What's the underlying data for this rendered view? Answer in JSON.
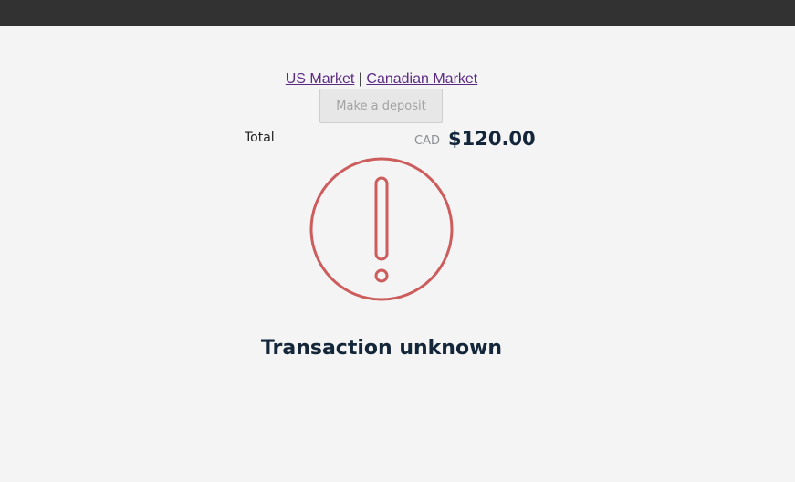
{
  "nav": {
    "us_market": "US Market",
    "separator": "|",
    "canadian_market": "Canadian Market"
  },
  "deposit": {
    "button_label": "Make a deposit"
  },
  "summary": {
    "total_label": "Total",
    "currency": "CAD",
    "amount": "$120.00"
  },
  "status": {
    "icon": "exclamation-circle-icon",
    "title": "Transaction unknown",
    "icon_color": "#cd5c5c"
  }
}
